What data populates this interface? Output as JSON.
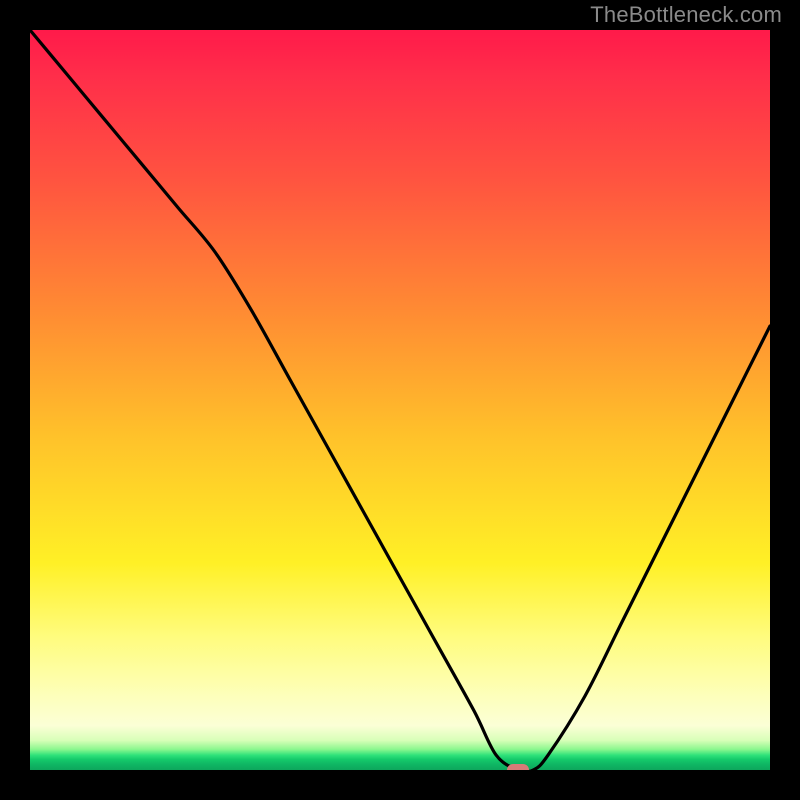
{
  "watermark": "TheBottleneck.com",
  "colors": {
    "background": "#000000",
    "curve": "#000000",
    "marker": "#d77b78",
    "gradient_top": "#ff1a4a",
    "gradient_bottom": "#0da65c"
  },
  "chart_data": {
    "type": "line",
    "title": "",
    "xlabel": "",
    "ylabel": "",
    "xlim": [
      0,
      100
    ],
    "ylim": [
      0,
      100
    ],
    "x": [
      0,
      5,
      10,
      15,
      20,
      25,
      30,
      35,
      40,
      45,
      50,
      55,
      60,
      63,
      66,
      68,
      70,
      75,
      80,
      85,
      90,
      95,
      100
    ],
    "values": [
      100,
      94,
      88,
      82,
      76,
      70,
      62,
      53,
      44,
      35,
      26,
      17,
      8,
      2,
      0,
      0,
      2,
      10,
      20,
      30,
      40,
      50,
      60
    ],
    "marker": {
      "x": 66,
      "y": 0
    },
    "marker_radius": [
      11,
      6
    ],
    "note": "Values read off the curve relative to the inner plot height; x is relative horizontal position in the gradient plot area."
  }
}
